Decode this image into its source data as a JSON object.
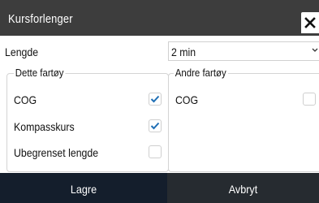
{
  "dialog": {
    "title": "Kursforlenger",
    "close_icon": "close-icon"
  },
  "length": {
    "label": "Lengde",
    "selected": "2 min",
    "dropdown_icon": "chevron-down-icon"
  },
  "own_vessel": {
    "legend": "Dette fartøy",
    "options": [
      {
        "label": "COG",
        "checked": true
      },
      {
        "label": "Kompasskurs",
        "checked": true
      },
      {
        "label": "Ubegrenset lengde",
        "checked": false
      }
    ]
  },
  "other_vessels": {
    "legend": "Andre fartøy",
    "options": [
      {
        "label": "COG",
        "checked": false
      }
    ]
  },
  "buttons": {
    "save": "Lagre",
    "cancel": "Avbryt"
  },
  "colors": {
    "titlebar": "#3d3d3d",
    "check": "#1f6fb5",
    "save_button": "#141e2c",
    "cancel_button": "#262b30"
  }
}
